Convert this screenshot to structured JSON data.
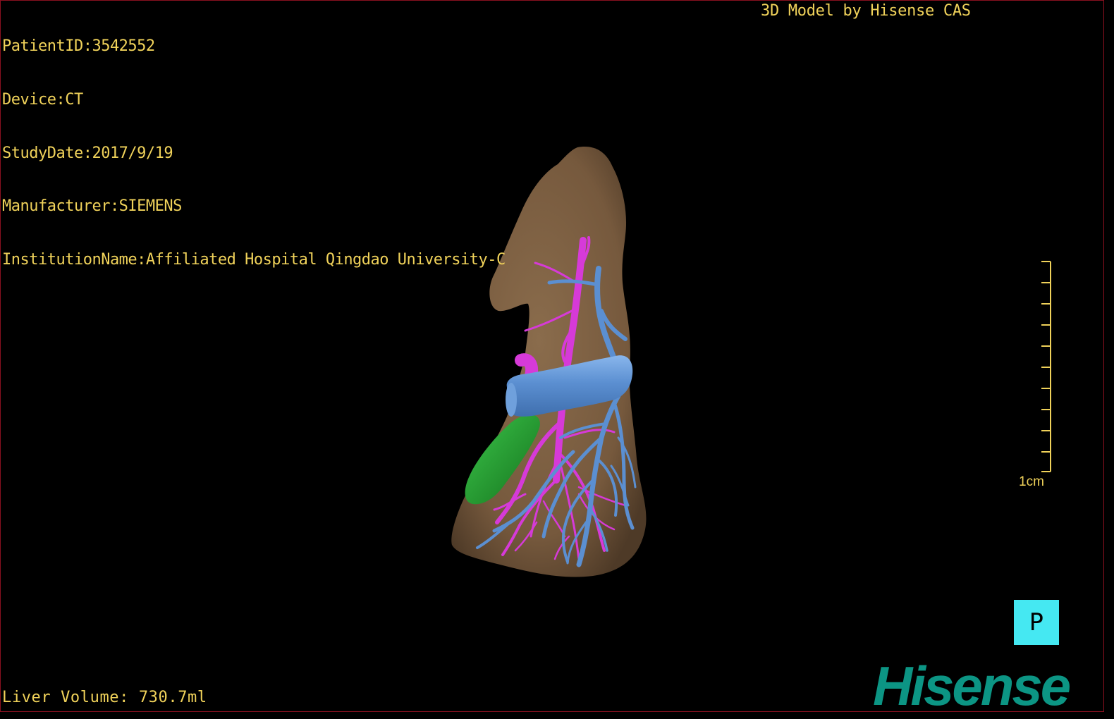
{
  "viewer": {
    "patient_line": "PatientID:3542552",
    "device_line": "Device:CT",
    "study_date_line": "StudyDate:2017/9/19",
    "manufacturer_line": "Manufacturer:SIEMENS",
    "institution_line": "InstitutionName:Affiliated Hospital Qingdao University-C",
    "model_credit": "3D Model by Hisense CAS",
    "liver_volume_line": "Liver Volume: 730.7ml",
    "scale_label": "1cm",
    "orientation_marker": "P",
    "logo_text": "Hisense"
  },
  "colors": {
    "overlay_text": "#f0d25a",
    "liver": "#7f6446",
    "portal_vein": "#5b8fd1",
    "artery": "#d63ad8",
    "gallbladder": "#1f9c2a",
    "orientation_cube": "#45e8f2",
    "logo": "#0c9584",
    "frame_border": "#8a1020"
  },
  "icons": {
    "orientation": "orientation-cube-icon",
    "scale": "scale-ruler-icon"
  }
}
